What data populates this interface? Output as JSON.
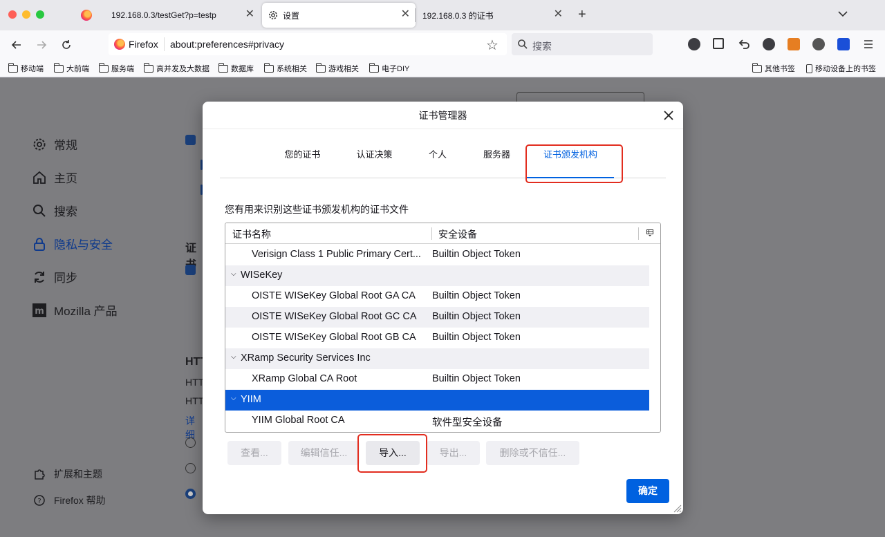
{
  "browser": {
    "tabs": [
      {
        "title": "192.168.0.3/testGet?p=testp"
      },
      {
        "title": "设置",
        "active": true
      },
      {
        "title": "192.168.0.3 的证书"
      }
    ],
    "identity_label": "Firefox",
    "url": "about:preferences#privacy",
    "search_placeholder": "搜索",
    "bookmarks": [
      "移动端",
      "大前端",
      "服务端",
      "高并发及大数据",
      "数据库",
      "系统相关",
      "游戏相关",
      "电子DIY"
    ],
    "bookmarks_right": [
      "其他书签",
      "移动设备上的书签"
    ]
  },
  "preferences": {
    "sidebar": [
      {
        "label": "常规",
        "icon": "gear-icon"
      },
      {
        "label": "主页",
        "icon": "home-icon"
      },
      {
        "label": "搜索",
        "icon": "search-icon"
      },
      {
        "label": "隐私与安全",
        "icon": "lock-icon",
        "active": true
      },
      {
        "label": "同步",
        "icon": "sync-icon"
      },
      {
        "label": "Mozilla 产品",
        "icon": "mozilla-icon"
      }
    ],
    "footer": [
      {
        "label": "扩展和主题",
        "icon": "puzzle-icon"
      },
      {
        "label": "Firefox 帮助",
        "icon": "help-icon"
      }
    ],
    "partial_texts": {
      "cert_heading": "证书",
      "https_heading": "HTT",
      "https_line1": "HTT",
      "https_line2": "HTT",
      "details_link": "详细"
    }
  },
  "dialog": {
    "title": "证书管理器",
    "tabs": [
      {
        "label": "您的证书"
      },
      {
        "label": "认证决策"
      },
      {
        "label": "个人"
      },
      {
        "label": "服务器"
      },
      {
        "label": "证书颁发机构",
        "selected": true
      }
    ],
    "description": "您有用来识别这些证书颁发机构的证书文件",
    "columns": [
      "证书名称",
      "安全设备"
    ],
    "rows": [
      {
        "type": "cert",
        "name": "Verisign Class 1 Public Primary Cert...",
        "device": "Builtin Object Token"
      },
      {
        "type": "group",
        "name": "WISeKey"
      },
      {
        "type": "cert",
        "name": "OISTE WISeKey Global Root GA CA",
        "device": "Builtin Object Token"
      },
      {
        "type": "cert",
        "name": "OISTE WISeKey Global Root GC CA",
        "device": "Builtin Object Token"
      },
      {
        "type": "cert",
        "name": "OISTE WISeKey Global Root GB CA",
        "device": "Builtin Object Token"
      },
      {
        "type": "group",
        "name": "XRamp Security Services Inc"
      },
      {
        "type": "cert",
        "name": "XRamp Global CA Root",
        "device": "Builtin Object Token"
      },
      {
        "type": "group",
        "name": "YIIM",
        "selected": true
      },
      {
        "type": "cert",
        "name": "YIIM Global Root CA",
        "device": "软件型安全设备"
      }
    ],
    "buttons": {
      "view": "查看...",
      "edit_trust": "编辑信任...",
      "import": "导入...",
      "export": "导出...",
      "delete": "删除或不信任..."
    },
    "ok": "确定",
    "colors": {
      "accent": "#0061e0",
      "selection": "#0b5ddb",
      "highlight": "#e22d1f"
    }
  }
}
